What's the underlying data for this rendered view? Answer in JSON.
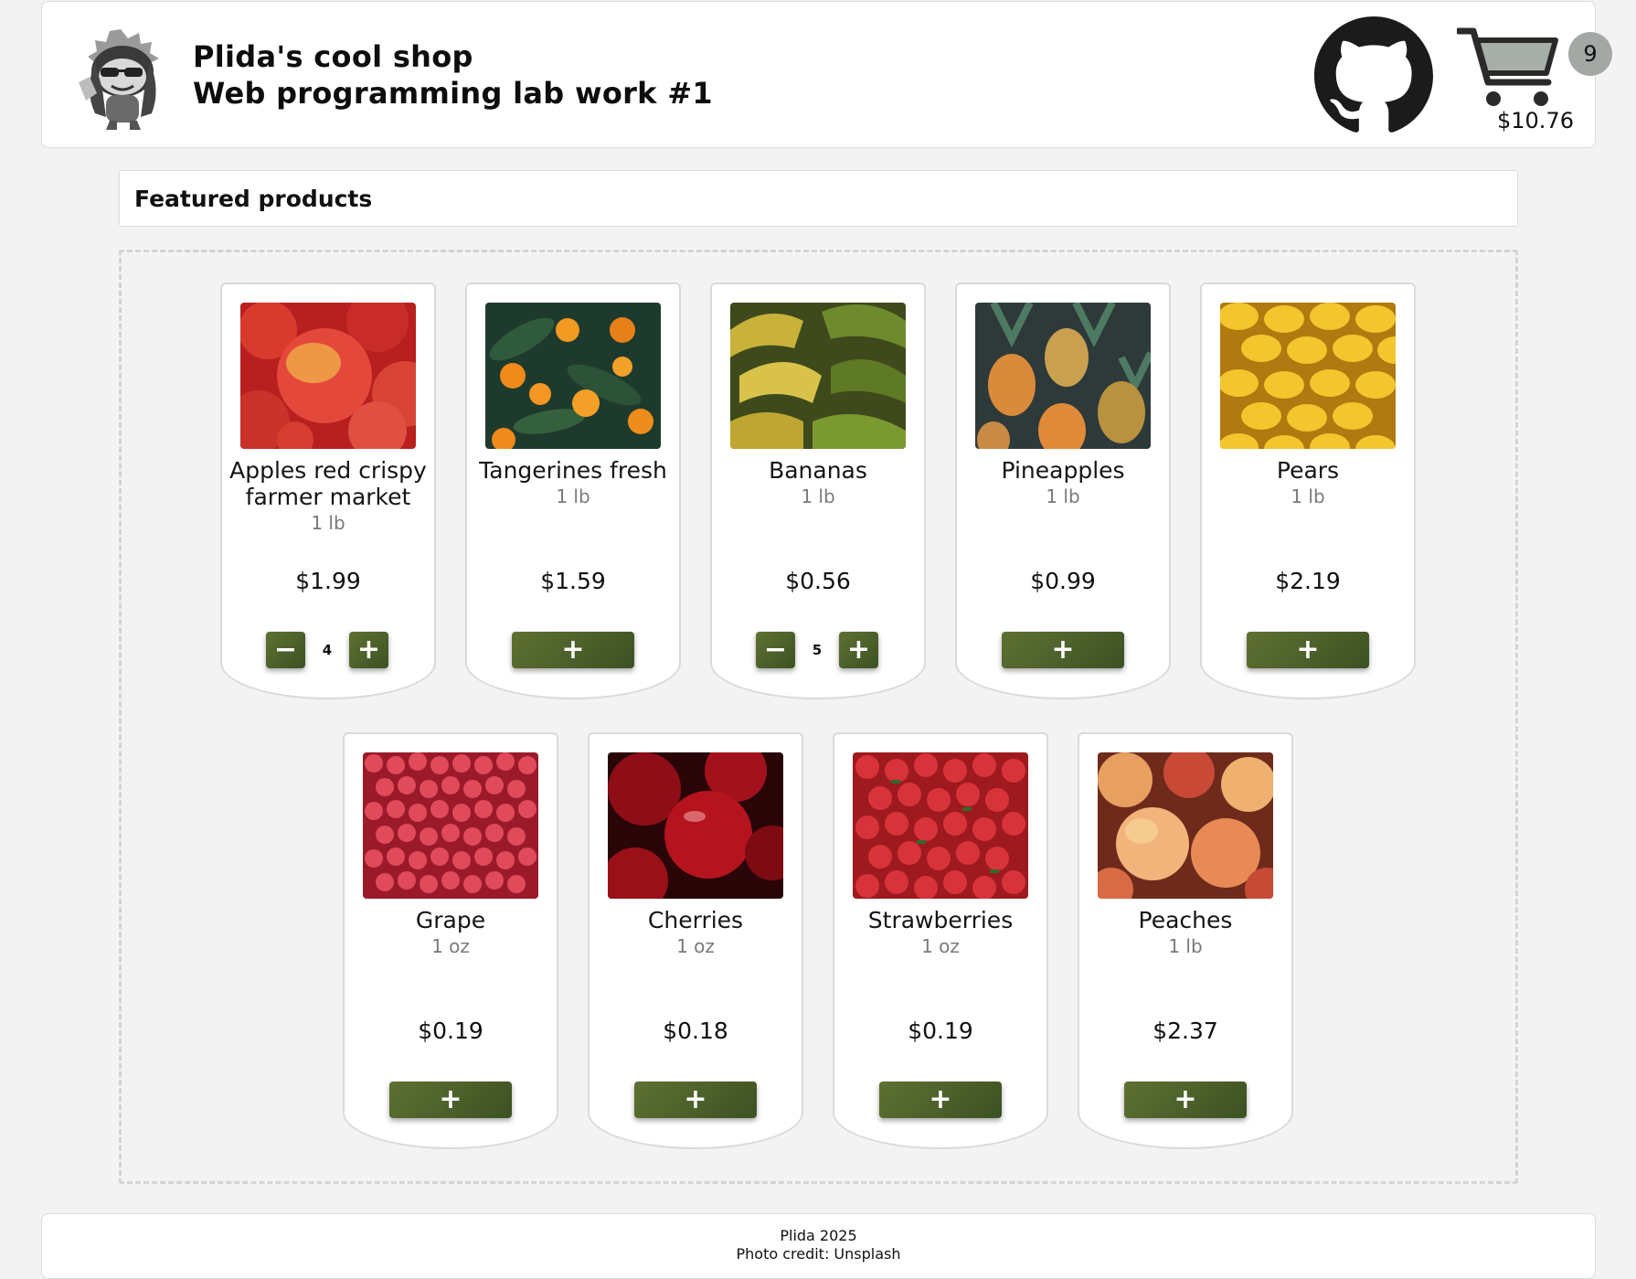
{
  "header": {
    "shop_name": "Plida's cool shop",
    "subtitle": "Web programming lab work #1",
    "mascot_icon": "mascot-logo",
    "github_icon": "github-icon",
    "cart": {
      "icon": "cart-icon",
      "count": "9",
      "total": "$10.76"
    }
  },
  "featured": {
    "title": "Featured products"
  },
  "products": [
    {
      "name": "Apples red crispy farmer market",
      "unit": "1 lb",
      "price": "$1.99",
      "quantity": "4",
      "in_cart": true
    },
    {
      "name": "Tangerines fresh",
      "unit": "1 lb",
      "price": "$1.59",
      "in_cart": false
    },
    {
      "name": "Bananas",
      "unit": "1 lb",
      "price": "$0.56",
      "quantity": "5",
      "in_cart": true
    },
    {
      "name": "Pineapples",
      "unit": "1 lb",
      "price": "$0.99",
      "in_cart": false
    },
    {
      "name": "Pears",
      "unit": "1 lb",
      "price": "$2.19",
      "in_cart": false
    },
    {
      "name": "Grape",
      "unit": "1 oz",
      "price": "$0.19",
      "in_cart": false
    },
    {
      "name": "Cherries",
      "unit": "1 oz",
      "price": "$0.18",
      "in_cart": false
    },
    {
      "name": "Strawberries",
      "unit": "1 oz",
      "price": "$0.19",
      "in_cart": false
    },
    {
      "name": "Peaches",
      "unit": "1 lb",
      "price": "$2.37",
      "in_cart": false
    }
  ],
  "buttons": {
    "add": "+",
    "minus": "−",
    "plus": "+"
  },
  "colors": {
    "button_start": "#5e7132",
    "button_end": "#3c5123",
    "badge": "#a4a8a4"
  },
  "footer": {
    "line1": "Plida 2025",
    "line2": "Photo credit: Unsplash"
  }
}
